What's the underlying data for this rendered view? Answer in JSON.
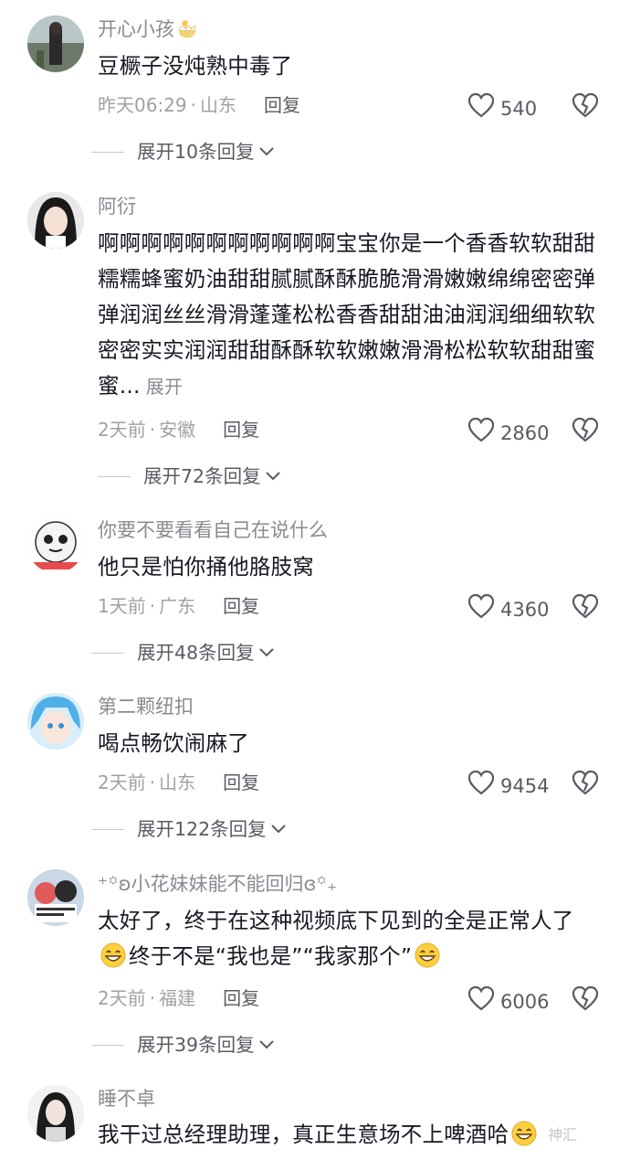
{
  "comments": [
    {
      "username": "开心小孩",
      "text": "豆橛子没炖熟中毒了",
      "time": "昨天06:29",
      "location": "山东",
      "reply_label": "回复",
      "likes": "540",
      "replies_label": "展开10条回复"
    },
    {
      "username": "阿衍",
      "text": "啊啊啊啊啊啊啊啊啊啊啊宝宝你是一个香香软软甜甜糯糯蜂蜜奶油甜甜腻腻酥酥脆脆滑滑嫩嫩绵绵密密弹弹润润丝丝滑滑蓬蓬松松香香甜甜油油润润细细软软密密实实润润甜甜酥酥软软嫩嫩滑滑松松软软甜甜蜜蜜...",
      "expand_label": "展开",
      "time": "2天前",
      "location": "安徽",
      "reply_label": "回复",
      "likes": "2860",
      "replies_label": "展开72条回复"
    },
    {
      "username": "你要不要看看自己在说什么",
      "text": "他只是怕你捅他胳肢窝",
      "time": "1天前",
      "location": "广东",
      "reply_label": "回复",
      "likes": "4360",
      "replies_label": "展开48条回复"
    },
    {
      "username": "第二颗纽扣",
      "text": "喝点畅饮闹麻了",
      "time": "2天前",
      "location": "山东",
      "reply_label": "回复",
      "likes": "9454",
      "replies_label": "展开122条回复"
    },
    {
      "username": "⁺꙳ʚ小花妹妹能不能回归ɞ꙳₊",
      "text_part1": "太好了，终于在这种视频底下见到的全是正常人了",
      "text_part2": "终于不是“我也是”“我家那个”",
      "time": "2天前",
      "location": "福建",
      "reply_label": "回复",
      "likes": "6006",
      "replies_label": "展开39条回复"
    },
    {
      "username": "睡不卓",
      "text": "我干过总经理助理，真正生意场不上啤酒哈"
    }
  ],
  "watermark": "神汇",
  "colors": {
    "text": "#161823",
    "muted": "#a0a1a6",
    "username": "#8a8b91"
  }
}
